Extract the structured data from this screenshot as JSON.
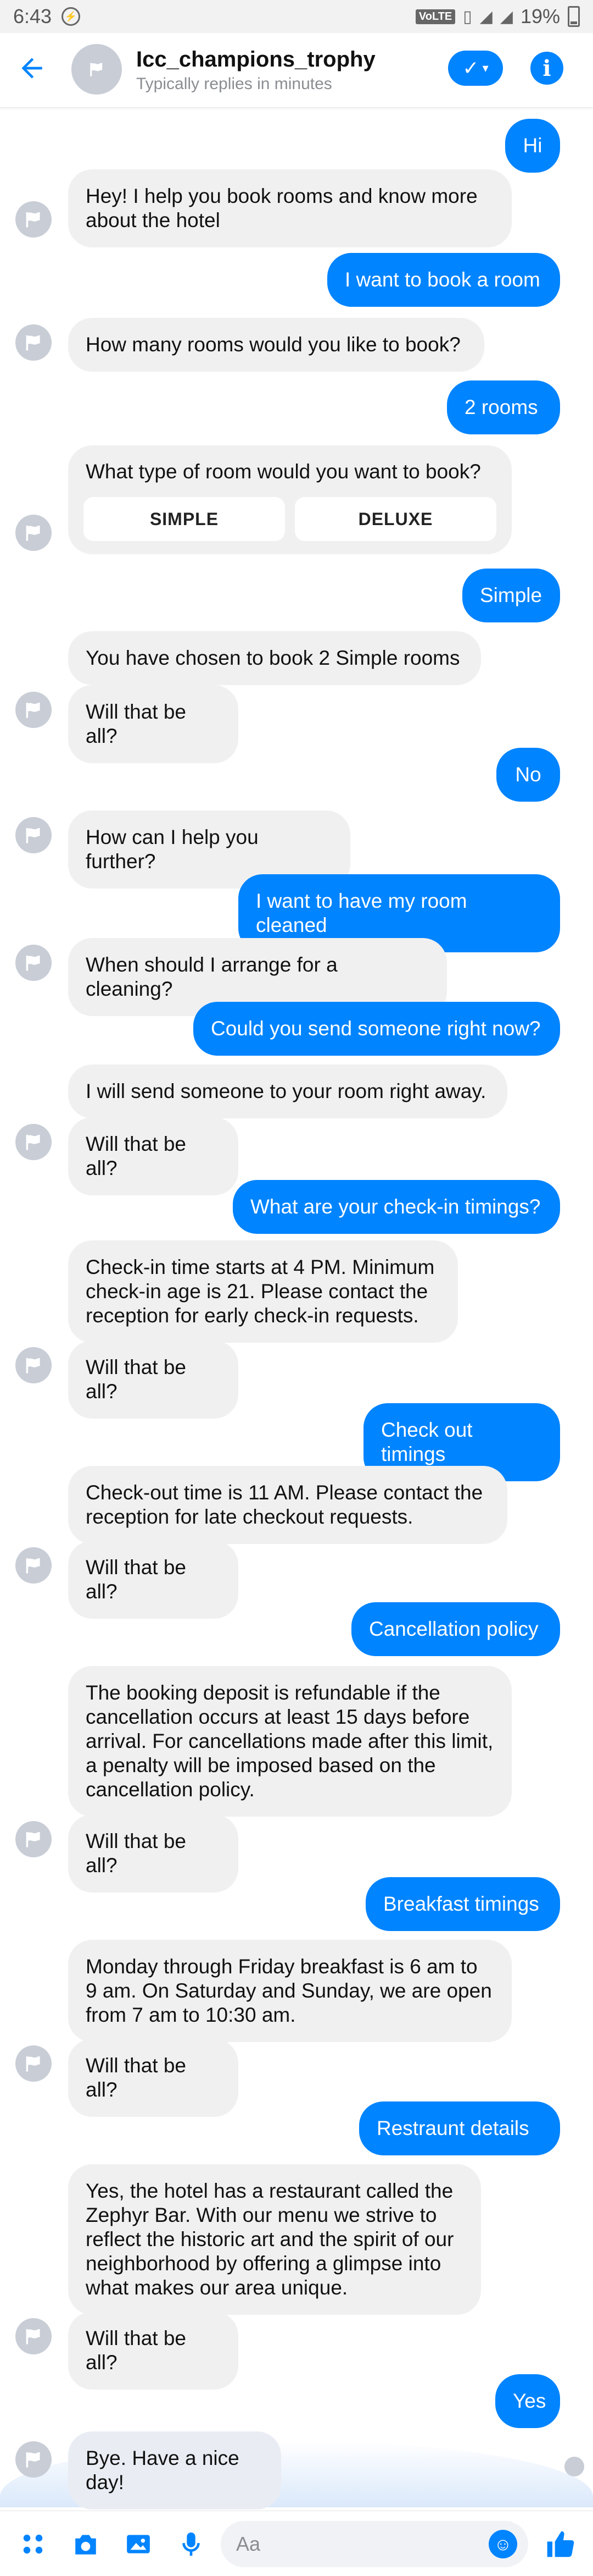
{
  "status_bar": {
    "time": "6:43",
    "network": "VoLTE",
    "battery": "19%"
  },
  "header": {
    "title": "Icc_champions_trophy",
    "subtitle": "Typically replies in minutes"
  },
  "messages": [
    {
      "dir": "out",
      "text": "Hi"
    },
    {
      "dir": "in",
      "text": "Hey! I help you book rooms and know more about the hotel"
    },
    {
      "dir": "out",
      "text": "I want to book a room"
    },
    {
      "dir": "in",
      "text": "How many rooms would you like to book?"
    },
    {
      "dir": "out",
      "text": "2 rooms"
    },
    {
      "dir": "in",
      "text": "What type of room would you want to book?",
      "buttons": [
        "SIMPLE",
        "DELUXE"
      ]
    },
    {
      "dir": "out",
      "text": "Simple"
    },
    {
      "dir": "in",
      "text": "You have chosen to book 2 Simple rooms"
    },
    {
      "dir": "in",
      "text": "Will that be all?"
    },
    {
      "dir": "out",
      "text": "No"
    },
    {
      "dir": "in",
      "text": "How can I help you further?"
    },
    {
      "dir": "out",
      "text": "I want to have my room cleaned"
    },
    {
      "dir": "in",
      "text": "When should I arrange for a cleaning?"
    },
    {
      "dir": "out",
      "text": "Could you send someone right now?"
    },
    {
      "dir": "in",
      "text": "I will send someone to your room right away."
    },
    {
      "dir": "in",
      "text": "Will that be all?"
    },
    {
      "dir": "out",
      "text": "What are your check-in timings?"
    },
    {
      "dir": "in",
      "text": "Check-in time starts at 4 PM. Minimum check-in age is 21. Please contact the reception for early check-in requests."
    },
    {
      "dir": "in",
      "text": "Will that be all?"
    },
    {
      "dir": "out",
      "text": "Check out timings"
    },
    {
      "dir": "in",
      "text": "Check-out time is 11 AM. Please contact the reception for late checkout requests."
    },
    {
      "dir": "in",
      "text": "Will that be all?"
    },
    {
      "dir": "out",
      "text": "Cancellation policy"
    },
    {
      "dir": "in",
      "text": "The booking deposit is refundable if the cancellation occurs at least 15 days before arrival. For cancellations made after this limit, a penalty will be imposed based on the cancellation policy."
    },
    {
      "dir": "in",
      "text": "Will that be all?"
    },
    {
      "dir": "out",
      "text": "Breakfast timings"
    },
    {
      "dir": "in",
      "text": "Monday through Friday breakfast is 6 am to 9 am. On Saturday and Sunday, we are open from 7 am to 10:30 am."
    },
    {
      "dir": "in",
      "text": "Will that be all?"
    },
    {
      "dir": "out",
      "text": "Restraunt details"
    },
    {
      "dir": "in",
      "text": "Yes, the hotel has a restaurant called the Zephyr Bar. With our menu we strive to reflect the historic art and the spirit of our neighborhood by offering a glimpse into what makes our area unique."
    },
    {
      "dir": "in",
      "text": "Will that be all?"
    },
    {
      "dir": "out",
      "text": "Yes"
    },
    {
      "dir": "in",
      "text": "Bye. Have a nice day!"
    }
  ],
  "composer": {
    "placeholder": "Aa",
    "icons": [
      "apps-icon",
      "camera-icon",
      "gallery-icon",
      "microphone-icon",
      "emoji-icon",
      "thumbs-up-icon"
    ]
  },
  "colors": {
    "accent": "#0084ff",
    "incoming_bubble": "#f0f0f0"
  }
}
